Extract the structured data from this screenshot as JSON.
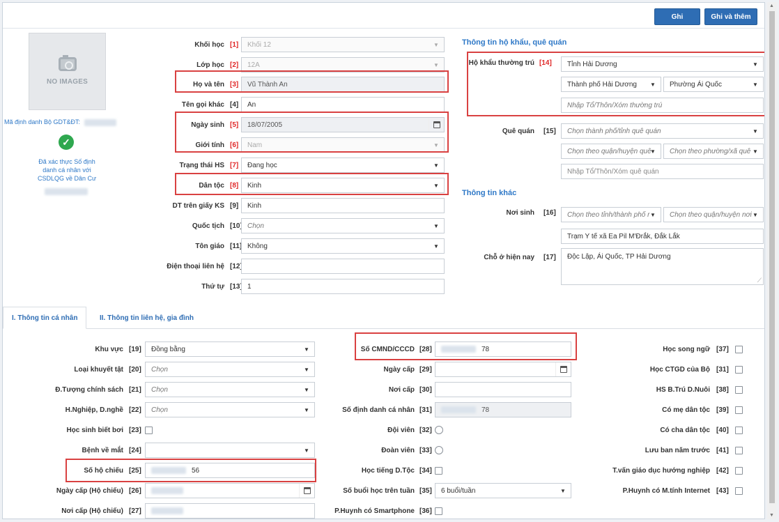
{
  "toolbar": {
    "save_label": "Ghi",
    "save_add_label": "Ghi và thêm"
  },
  "photo": {
    "no_image": "NO IMAGES"
  },
  "identity": {
    "label": "Mã định danh Bộ GDT&ĐT:",
    "verify_text": "Đã xác thực Số định danh cá nhân với CSDLQG về Dân Cư",
    "check_color": "#2fa84f"
  },
  "basic": [
    {
      "label": "Khối học",
      "num": "[1]",
      "req": true,
      "value": "Khối 12",
      "type": "select-ro"
    },
    {
      "label": "Lớp học",
      "num": "[2]",
      "req": true,
      "value": "12A",
      "type": "select-ro"
    },
    {
      "label": "Họ và tên",
      "num": "[3]",
      "req": true,
      "value": "Vũ Thành An",
      "type": "disabled"
    },
    {
      "label": "Tên gọi khác",
      "num": "[4]",
      "req": false,
      "value": "An",
      "type": "text"
    },
    {
      "label": "Ngày sinh",
      "num": "[5]",
      "req": true,
      "value": "18/07/2005",
      "type": "date-dis"
    },
    {
      "label": "Giới tính",
      "num": "[6]",
      "req": true,
      "value": "Nam",
      "type": "select-ro"
    },
    {
      "label": "Trạng thái HS",
      "num": "[7]",
      "req": true,
      "value": "Đang học",
      "type": "select"
    },
    {
      "label": "Dân tộc",
      "num": "[8]",
      "req": true,
      "value": "Kinh",
      "type": "select"
    },
    {
      "label": "DT trên giấy KS",
      "num": "[9]",
      "req": false,
      "value": "Kinh",
      "type": "text"
    },
    {
      "label": "Quốc tịch",
      "num": "[10]",
      "req": false,
      "value": "Chọn",
      "type": "select-ph"
    },
    {
      "label": "Tôn giáo",
      "num": "[11]",
      "req": false,
      "value": "Không",
      "type": "select"
    },
    {
      "label": "Điện thoại liên hệ",
      "num": "[12]",
      "req": false,
      "value": "",
      "type": "text"
    },
    {
      "label": "Thứ tự",
      "num": "[13]",
      "req": false,
      "value": "1",
      "type": "text"
    }
  ],
  "right": {
    "sect1": "Thông tin hộ khẩu, quê quán",
    "hokhau_label": "Hộ khẩu thường trú",
    "hokhau_num": "[14]",
    "hk_province": "Tỉnh Hải Dương",
    "hk_district": "Thành phố Hải Dương",
    "hk_ward": "Phường Ái Quốc",
    "hk_detail_ph": "Nhập Tổ/Thôn/Xóm thường trú",
    "quequan_label": "Quê quán",
    "quequan_num": "[15]",
    "qq_province_ph": "Chọn thành phố/tỉnh quê quán",
    "qq_district_ph": "Chọn theo quận/huyện quê",
    "qq_ward_ph": "Chọn theo phường/xã quê",
    "qq_detail_ph": "Nhập Tổ/Thôn/Xóm quê quán",
    "sect2": "Thông tin khác",
    "noisinh_label": "Nơi sinh",
    "noisinh_num": "[16]",
    "ns_province_ph": "Chọn theo tỉnh/thành phố r",
    "ns_district_ph": "Chọn theo quận/huyện nơi",
    "ns_detail": "Trạm Y tế xã Ea Pil M'Đrắk, Đắk Lắk",
    "choo_label": "Chỗ ở hiện nay",
    "choo_num": "[17]",
    "choo_value": "Độc Lập, Ái Quốc, TP Hải Dương"
  },
  "tabs": [
    {
      "label": "I. Thông tin cá nhân",
      "active": true
    },
    {
      "label": "II. Thông tin liên hệ, gia đình",
      "active": false
    }
  ],
  "col1": [
    {
      "label": "Khu vực",
      "num": "[19]",
      "value": "Đồng bằng",
      "type": "select"
    },
    {
      "label": "Loại khuyết tật",
      "num": "[20]",
      "value": "Chọn",
      "type": "select-ph"
    },
    {
      "label": "Đ.Tượng chính sách",
      "num": "[21]",
      "value": "Chọn",
      "type": "select-ph"
    },
    {
      "label": "H.Nghiệp, D.nghề",
      "num": "[22]",
      "value": "Chọn",
      "type": "select-ph"
    },
    {
      "label": "Học sinh biết bơi",
      "num": "[23]",
      "value": "",
      "type": "check"
    },
    {
      "label": "Bệnh về mắt",
      "num": "[24]",
      "value": "",
      "type": "select"
    },
    {
      "label": "Số hộ chiếu",
      "num": "[25]",
      "value": "56",
      "type": "masked"
    },
    {
      "label": "Ngày cấp (Hộ chiếu)",
      "num": "[26]",
      "value": "",
      "type": "date-masked"
    },
    {
      "label": "Nơi cấp (Hộ chiếu)",
      "num": "[27]",
      "value": "",
      "type": "masked-only"
    }
  ],
  "col2": [
    {
      "label": "Số CMND/CCCD",
      "num": "[28]",
      "value": "78",
      "type": "masked"
    },
    {
      "label": "Ngày cấp",
      "num": "[29]",
      "value": "",
      "type": "date"
    },
    {
      "label": "Nơi cấp",
      "num": "[30]",
      "value": "",
      "type": "text"
    },
    {
      "label": "Số định danh cá nhân",
      "num": "[31]",
      "value": "78",
      "type": "masked-dis"
    },
    {
      "label": "Đội viên",
      "num": "[32]",
      "value": "",
      "type": "radio"
    },
    {
      "label": "Đoàn viên",
      "num": "[33]",
      "value": "",
      "type": "radio"
    },
    {
      "label": "Học tiếng D.Tộc",
      "num": "[34]",
      "value": "",
      "type": "check"
    },
    {
      "label": "Số buổi học trên tuần",
      "num": "[35]",
      "value": "6 buổi/tuần",
      "type": "select"
    },
    {
      "label": "P.Huynh có Smartphone",
      "num": "[36]",
      "value": "",
      "type": "check"
    }
  ],
  "col3": [
    {
      "label": "Học song ngữ",
      "num": "[37]"
    },
    {
      "label": "Học CTGD của Bộ",
      "num": "[31]"
    },
    {
      "label": "HS B.Trú D.Nuôi",
      "num": "[38]"
    },
    {
      "label": "Có mẹ dân tộc",
      "num": "[39]"
    },
    {
      "label": "Có cha dân tộc",
      "num": "[40]"
    },
    {
      "label": "Lưu ban năm trước",
      "num": "[41]"
    },
    {
      "label": "T.vấn giáo dục hướng nghiệp",
      "num": "[42]"
    },
    {
      "label": "P.Huynh có M.tính Internet",
      "num": "[43]"
    }
  ]
}
